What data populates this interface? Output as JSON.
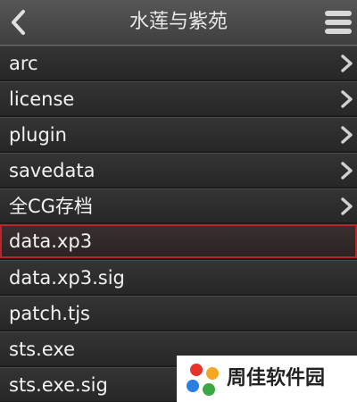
{
  "header": {
    "title": "水莲与紫苑",
    "back_icon": "chevron-left-icon",
    "menu_icon": "hamburger-menu-icon"
  },
  "files": [
    {
      "name": "arc",
      "is_folder": true,
      "selected": false
    },
    {
      "name": "license",
      "is_folder": true,
      "selected": false
    },
    {
      "name": "plugin",
      "is_folder": true,
      "selected": false
    },
    {
      "name": "savedata",
      "is_folder": true,
      "selected": false
    },
    {
      "name": "全CG存档",
      "is_folder": true,
      "selected": false
    },
    {
      "name": "data.xp3",
      "is_folder": false,
      "selected": true
    },
    {
      "name": "data.xp3.sig",
      "is_folder": false,
      "selected": false
    },
    {
      "name": "patch.tjs",
      "is_folder": false,
      "selected": false
    },
    {
      "name": "sts.exe",
      "is_folder": false,
      "selected": false
    },
    {
      "name": "sts.exe.sig",
      "is_folder": false,
      "selected": false
    }
  ],
  "watermark": {
    "text": "周佳软件园",
    "logo_icon": "pinwheel-logo-icon"
  },
  "colors": {
    "header_bg": "#4a4a4a",
    "row_bg": "#2e2e2e",
    "selected_border": "#b8262a",
    "text": "#f2f2f2"
  }
}
